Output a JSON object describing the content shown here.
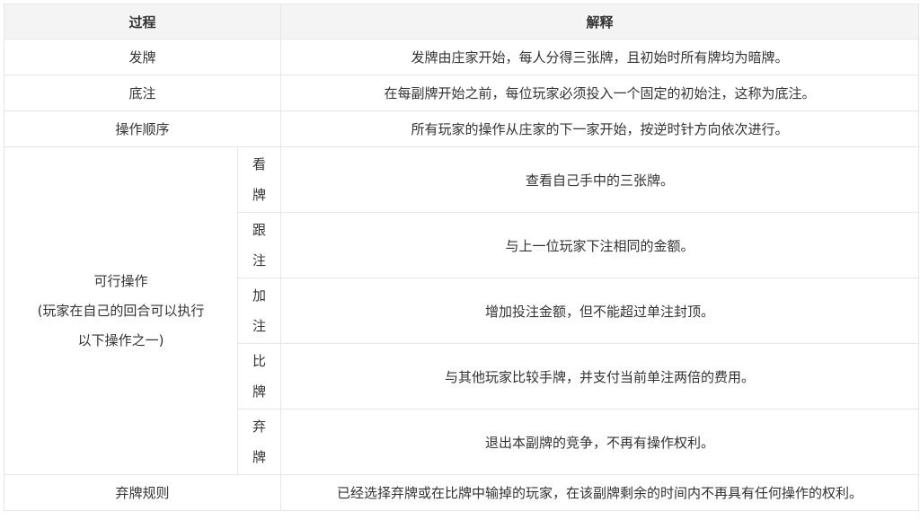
{
  "table": {
    "headers": [
      "过程",
      "解释"
    ],
    "rows": [
      {
        "label": "发牌",
        "desc": "发牌由庄家开始，每人分得三张牌，且初始时所有牌均为暗牌。"
      },
      {
        "label": "底注",
        "desc": "在每副牌开始之前，每位玩家必须投入一个固定的初始注，这称为底注。"
      },
      {
        "label": "操作顺序",
        "desc": "所有玩家的操作从庄家的下一家开始，按逆时针方向依次进行。"
      }
    ],
    "group": {
      "label_lines": [
        "可行操作",
        "(玩家在自己的回合可以执行",
        "以下操作之一)"
      ],
      "actions": [
        {
          "chars": [
            "看",
            "牌"
          ],
          "desc": "查看自己手中的三张牌。"
        },
        {
          "chars": [
            "跟",
            "注"
          ],
          "desc": "与上一位玩家下注相同的金额。"
        },
        {
          "chars": [
            "加",
            "注"
          ],
          "desc": "增加投注金额，但不能超过单注封顶。"
        },
        {
          "chars": [
            "比",
            "牌"
          ],
          "desc": "与其他玩家比较手牌，并支付当前单注两倍的费用。"
        },
        {
          "chars": [
            "弃",
            "牌"
          ],
          "desc": "退出本副牌的竞争，不再有操作权利。"
        }
      ]
    },
    "last_row": {
      "label": "弃牌规则",
      "desc": "已经选择弃牌或在比牌中输掉的玩家，在该副牌剩余的时间内不再具有任何操作的权利。"
    }
  }
}
